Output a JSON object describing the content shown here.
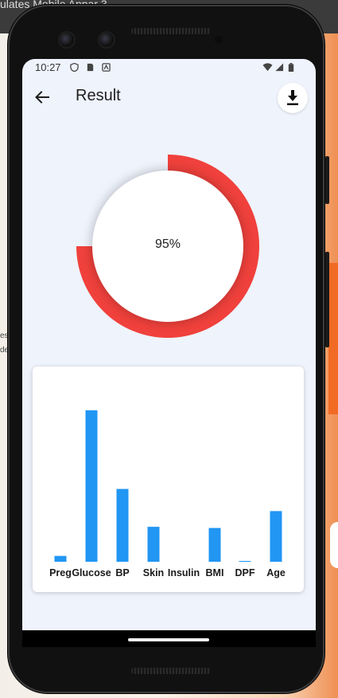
{
  "desktop": {
    "window_title": "ulates Mobile Appar 3",
    "edge_text_1": "ess",
    "edge_text_2": "de"
  },
  "status_bar": {
    "time": "10:27"
  },
  "app_bar": {
    "title": "Result",
    "back_icon": "arrow-back-icon",
    "download_icon": "download-icon"
  },
  "gauge": {
    "label": "95%",
    "fraction": 0.75,
    "color": "#f0413c"
  },
  "chart_data": {
    "type": "bar",
    "categories": [
      "Preg",
      "Glucose",
      "BP",
      "Skin",
      "Insulin",
      "BMI",
      "DPF",
      "Age"
    ],
    "values": [
      1,
      26,
      12.5,
      6,
      0,
      5.8,
      0.1,
      8.7
    ],
    "ylim": [
      0,
      29
    ],
    "bar_color": "#2196f3",
    "title": "",
    "xlabel": "",
    "ylabel": ""
  }
}
